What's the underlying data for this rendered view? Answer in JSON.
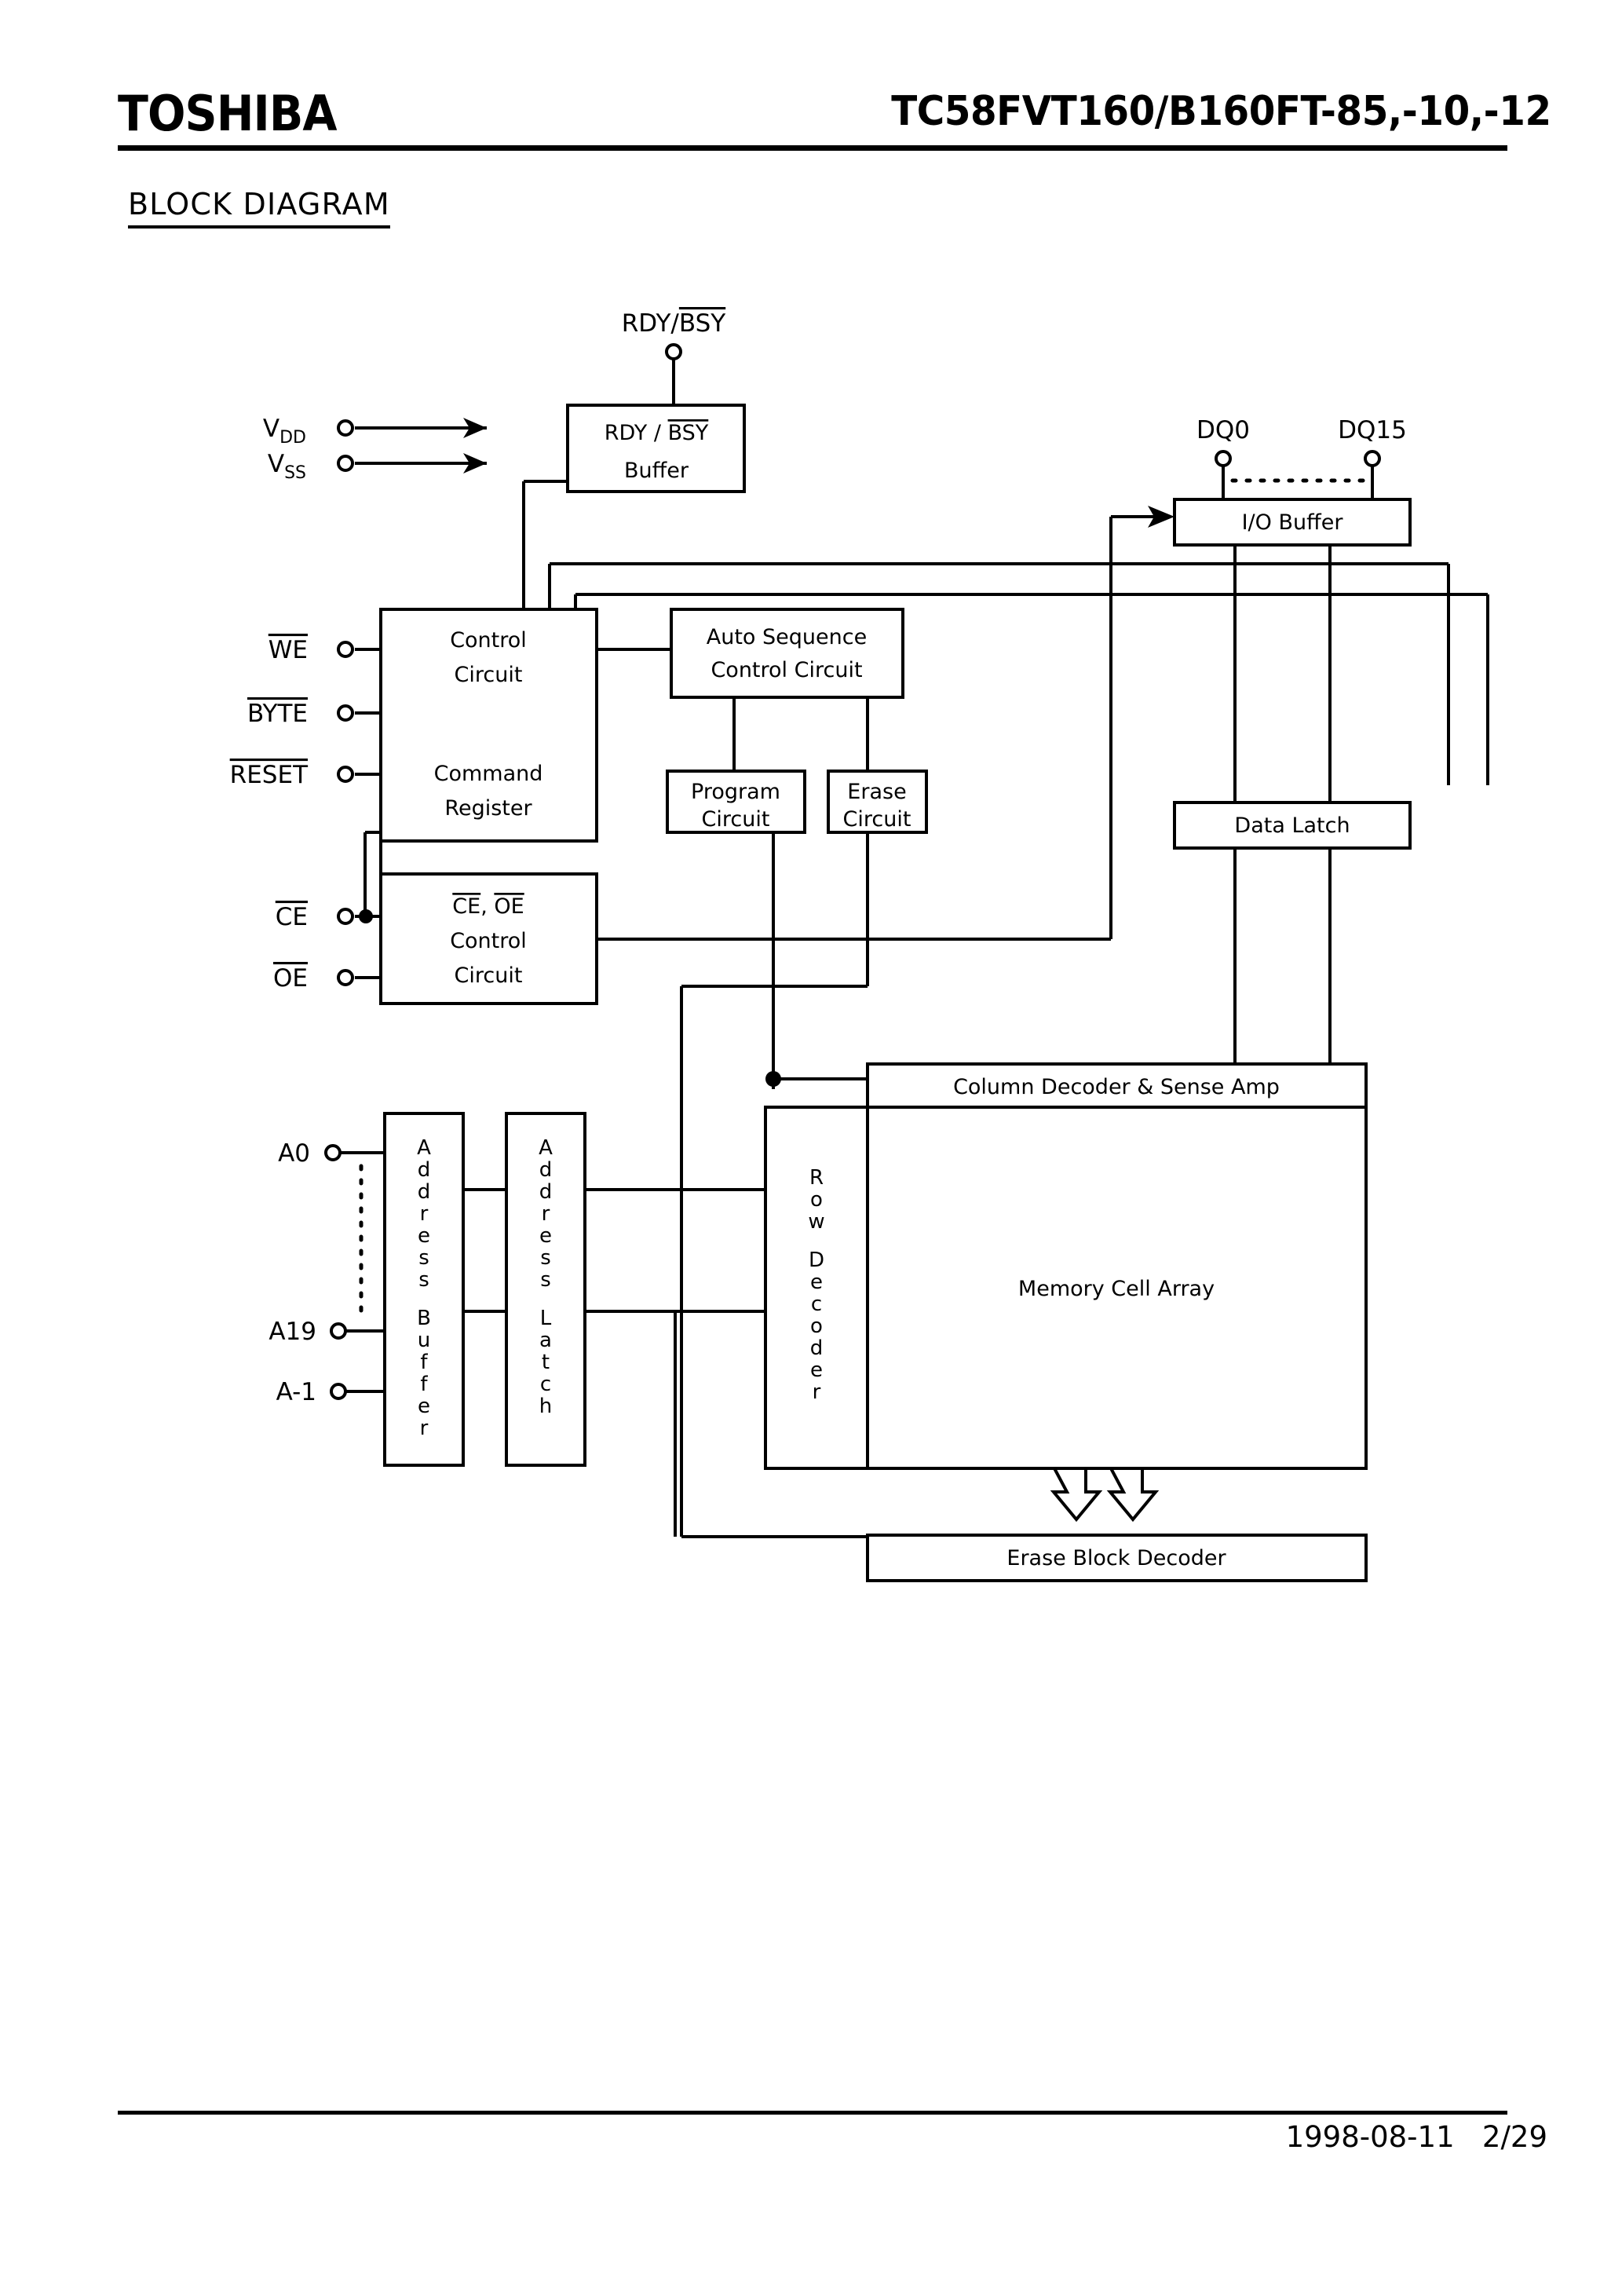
{
  "header": {
    "brand": "TOSHIBA",
    "part_number": "TC58FVT160/B160FT-85,-10,-12"
  },
  "section": {
    "title": "BLOCK  DIAGRAM"
  },
  "footer": {
    "date": "1998-08-11",
    "page": "2/29"
  },
  "pins": {
    "vdd": "V",
    "vdd_sub": "DD",
    "vss": "V",
    "vss_sub": "SS",
    "rdy_bsy_top": "RDY/",
    "rdy_bsy_top_bar": "BSY",
    "we": "WE",
    "byte": "BYTE",
    "reset": "RESET",
    "ce": "CE",
    "oe": "OE",
    "dq0": "DQ0",
    "dq15": "DQ15",
    "a0": "A0",
    "a19": "A19",
    "am1": "A-1"
  },
  "blocks": {
    "rdy_buffer_line1_a": "RDY / ",
    "rdy_buffer_line1_b": "BSY",
    "rdy_buffer_line2": "Buffer",
    "io_buffer": "I/O Buffer",
    "control_circuit_line1": "Control",
    "control_circuit_line2": "Circuit",
    "command_register_line1": "Command",
    "command_register_line2": "Register",
    "auto_sequence_line1": "Auto Sequence",
    "auto_sequence_line2": "Control Circuit",
    "program_circuit_line1": "Program",
    "program_circuit_line2": "Circuit",
    "erase_circuit_line1": "Erase",
    "erase_circuit_line2": "Circuit",
    "ce_oe_line1_a": "CE",
    "ce_oe_line1_b": ", ",
    "ce_oe_line1_c": "OE",
    "ce_oe_line2": "Control",
    "ce_oe_line3": "Circuit",
    "data_latch": "Data Latch",
    "column_decoder": "Column Decoder & Sense Amp",
    "memory_cell_array": "Memory Cell Array",
    "erase_block_decoder": "Erase Block Decoder",
    "address_buffer": "Address Buffer",
    "address_latch": "Address Latch",
    "row_decoder": "Row Decoder"
  },
  "colors": {
    "ink": "#000000",
    "paper": "#ffffff"
  }
}
